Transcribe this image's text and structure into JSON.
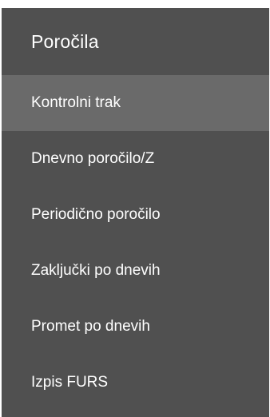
{
  "menu": {
    "title": "Poročila",
    "items": [
      {
        "label": "Kontrolni trak",
        "selected": true
      },
      {
        "label": "Dnevno poročilo/Z",
        "selected": false
      },
      {
        "label": "Periodično poročilo",
        "selected": false
      },
      {
        "label": "Zaključki po dnevih",
        "selected": false
      },
      {
        "label": "Promet po dnevih",
        "selected": false
      },
      {
        "label": "Izpis FURS",
        "selected": false
      }
    ]
  },
  "colors": {
    "background": "#505050",
    "selected_background": "#6a6a6a",
    "text": "#ffffff"
  }
}
